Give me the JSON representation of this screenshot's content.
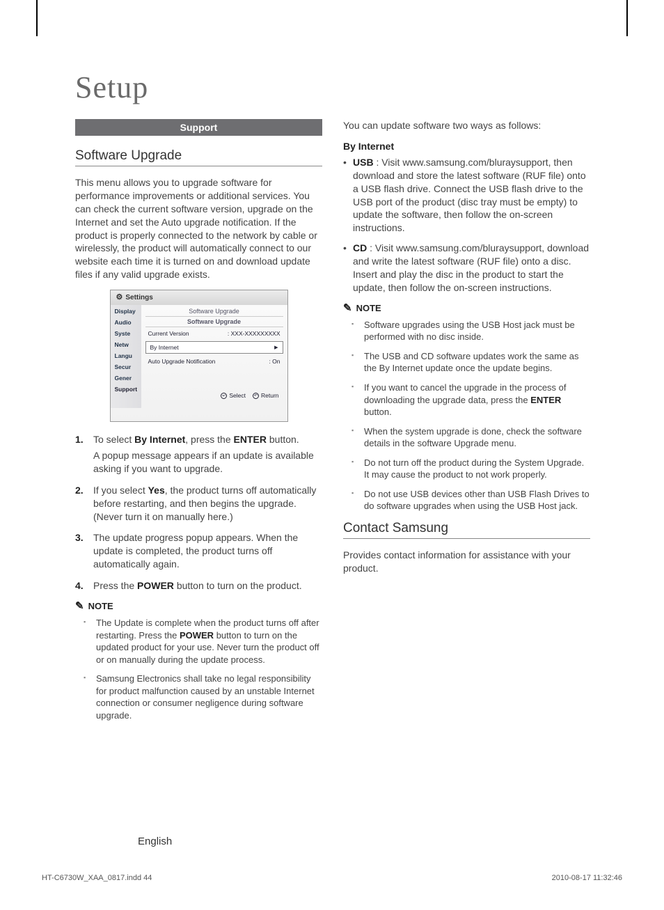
{
  "title": "Setup",
  "note_label": "NOTE",
  "left": {
    "sectionBar": "Support",
    "h_software": "Software Upgrade",
    "intro": "This menu allows you to upgrade software for performance improvements or additional services. You can check the current software version, upgrade on the Internet and set the Auto upgrade notification. If the product is properly connected to the network by cable or wirelessly, the product will automatically connect to our website each time it is turned on and download update files if any valid upgrade exists.",
    "steps": [
      {
        "a": "To select",
        "b": "By Internet",
        "c": ", press the",
        "d": "ENTER",
        "e": "button.",
        "sub": "A popup message appears if an update is available asking if you want to upgrade."
      },
      {
        "a": "If you select",
        "b": "Yes",
        "c": ", the product turns off automatically before restarting, and then begins the upgrade. (Never turn it on manually here.)"
      },
      {
        "a": "The update progress popup appears. When the update is completed, the product turns off automatically again."
      },
      {
        "a": "Press the",
        "b": "POWER",
        "c": "button to turn on the product."
      }
    ],
    "notes": [
      {
        "a": "The Update is complete when the product turns off after restarting. Press the",
        "b": "POWER",
        "c": "button to turn on the updated product for your use. Never turn the product off or on manually during the update process."
      },
      {
        "a": "Samsung Electronics shall take no legal responsibility for product malfunction caused by an unstable Internet connection or consumer negligence during software upgrade."
      }
    ]
  },
  "right": {
    "intro": "You can update software two ways as follows:",
    "by_internet_h": "By Internet",
    "bullets": [
      {
        "label": "USB",
        "text": ": Visit www.samsung.com/bluraysupport, then download and store the latest software (RUF file) onto a USB flash drive. Connect the USB flash drive to the USB port of the product (disc tray must be empty) to update the software, then follow the on-screen instructions."
      },
      {
        "label": "CD",
        "text": ": Visit www.samsung.com/bluraysupport, download and write the latest software (RUF file) onto a disc. Insert and play the disc in the product to start the update, then follow the on-screen instructions."
      }
    ],
    "notes": [
      "Software upgrades using the USB Host jack must be performed with no disc inside.",
      "The USB and CD software updates work the same as the By Internet update once the update begins.",
      "If you want to cancel the upgrade in the process of downloading the upgrade data, press the",
      "When the system upgrade is done, check the software details in the software Upgrade menu.",
      "Do not turn off the product during the System Upgrade. It may cause the product to not work properly.",
      "Do not use USB devices other than USB Flash Drives to do software upgrades when using the USB Host jack."
    ],
    "notes2a_index_comment": "note index 2 split into a/b/c for bold ENTER",
    "notes_placeholder": "",
    "notes2b": "",
    "notes2c": "",
    "notes2a": "",
    "contact_h": "Contact Samsung",
    "contact_p": "Provides contact information for assistance with your product."
  },
  "right_note2_parts": {
    "a": "If you want to cancel the upgrade in the process of downloading the upgrade data, press the",
    "b": "ENTER",
    "c": "button."
  },
  "ui": {
    "title": "Settings",
    "nav": [
      "Display",
      "Audio",
      "Syste",
      "Netw",
      "Langu",
      "Secur",
      "Gener",
      "Support"
    ],
    "main_h1": "Software Upgrade",
    "main_h2": "Software Upgrade",
    "cv_label": "Current Version",
    "cv_value": ": XXX-XXXXXXXXX",
    "by_internet": "By Internet",
    "auto_label": "Auto Upgrade Notification",
    "auto_value": ": On",
    "select": "Select",
    "return": "Return"
  },
  "footer": {
    "lang": "English",
    "file": "HT-C6730W_XAA_0817.indd   44",
    "time": "2010-08-17   11:32:46"
  }
}
